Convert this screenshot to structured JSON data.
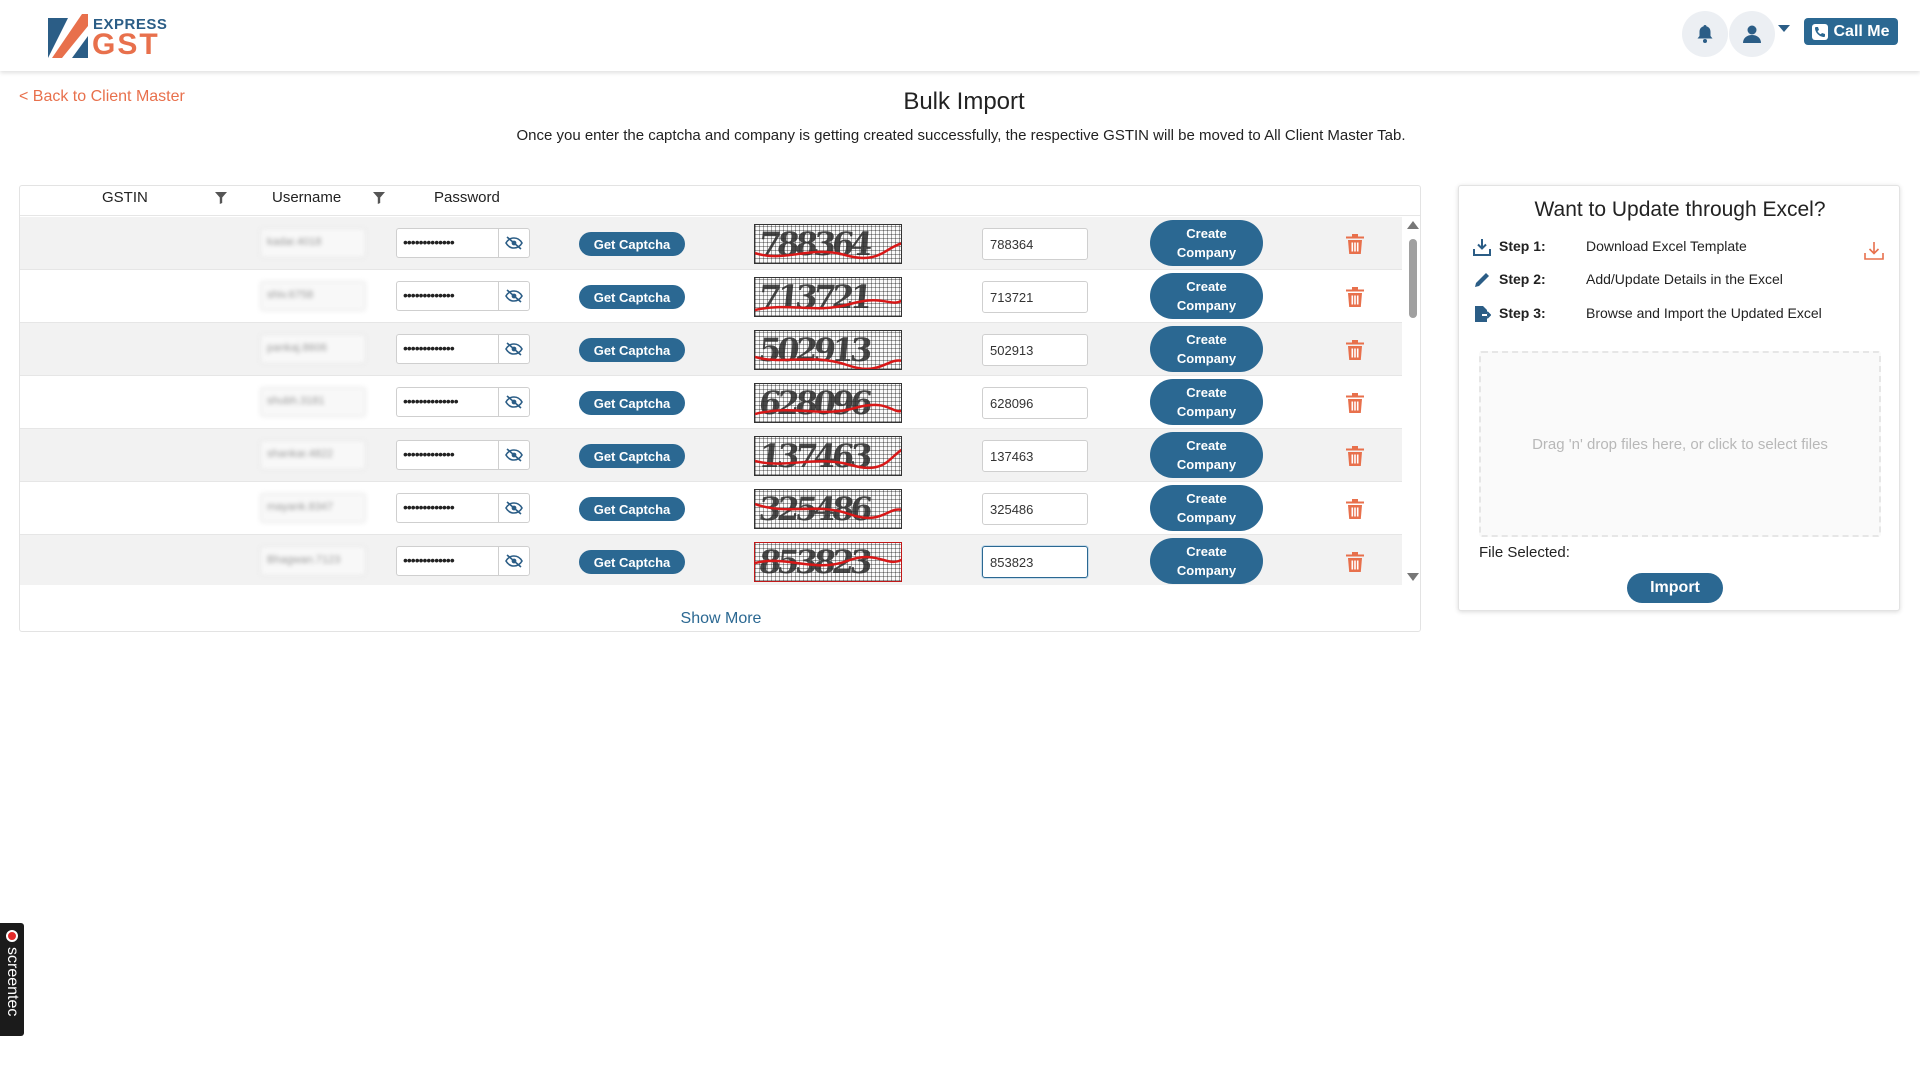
{
  "header": {
    "logo_top": "EXPRESS",
    "logo_main": "GST",
    "call_label": "Call Me",
    "colors": {
      "primary": "#2b6892",
      "accent": "#e8704c"
    }
  },
  "page": {
    "back_link": "< Back to Client Master",
    "title": "Bulk Import",
    "subtitle": "Once you enter the captcha and company is getting created successfully, the respective GSTIN will be moved to All Client Master Tab."
  },
  "table": {
    "columns": {
      "gstin": "GSTIN",
      "username": "Username",
      "password": "Password"
    },
    "get_captcha_label": "Get Captcha",
    "create_company_label": "Create Company",
    "rows": [
      {
        "username": "kadar.4018",
        "password_mask": "•••••••••••••",
        "captcha_image_text": "788364",
        "captcha_value": "788364"
      },
      {
        "username": "shiv.6758",
        "password_mask": "•••••••••••••",
        "captcha_image_text": "713721",
        "captcha_value": "713721"
      },
      {
        "username": "pankaj.8606",
        "password_mask": "•••••••••••••",
        "captcha_image_text": "502913",
        "captcha_value": "502913"
      },
      {
        "username": "shubh.3181",
        "password_mask": "••••••••••••••",
        "captcha_image_text": "628096",
        "captcha_value": "628096"
      },
      {
        "username": "shankar.4822",
        "password_mask": "•••••••••••••",
        "captcha_image_text": "137463",
        "captcha_value": "137463"
      },
      {
        "username": "mayank.8347",
        "password_mask": "•••••••••••••",
        "captcha_image_text": "325486",
        "captcha_value": "325486"
      },
      {
        "username": "Bhagwan.7123",
        "password_mask": "•••••••••••••",
        "captcha_image_text": "853823",
        "captcha_value": "853823"
      }
    ],
    "show_more": "Show More"
  },
  "excel": {
    "title": "Want to Update through Excel?",
    "steps": [
      {
        "label": "Step 1:",
        "text": "Download Excel Template",
        "icon": "download-icon"
      },
      {
        "label": "Step 2:",
        "text": "Add/Update Details in the Excel",
        "icon": "pencil-icon"
      },
      {
        "label": "Step 3:",
        "text": "Browse and Import the Updated Excel",
        "icon": "file-import-icon"
      }
    ],
    "dropzone": "Drag 'n' drop files here, or click to select files",
    "file_selected": "File Selected:",
    "import_label": "Import"
  },
  "recorder": {
    "label": "screentec"
  }
}
